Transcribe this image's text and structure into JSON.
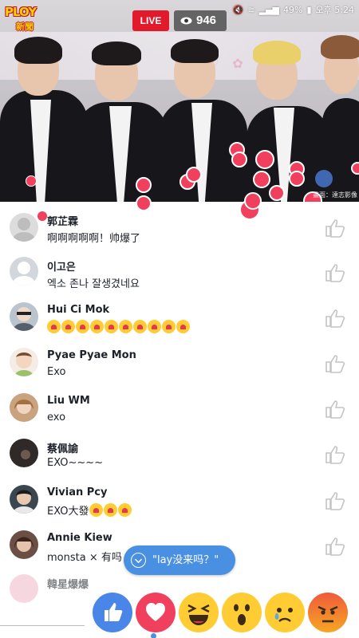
{
  "app": {
    "logo_top": "PLOY",
    "logo_bottom": "新聞"
  },
  "live": {
    "badge": "LIVE",
    "viewers": "946"
  },
  "status_bar": {
    "battery": "49%",
    "time": "오후 5:24"
  },
  "video": {
    "watermark": "畫面：達志影像",
    "backdrop_text": "♡ ✿"
  },
  "comments": [
    {
      "name": "郭芷霖",
      "text": "啊啊啊啊啊！帅爆了",
      "avatar": "#d8d8d8"
    },
    {
      "name": "이고은",
      "text": "엑소 존나 잘생겼네요",
      "avatar": "#cfd3d9"
    },
    {
      "name": "Hui Ci Mok",
      "text": "",
      "emoji_count": 10,
      "avatar": "#b7c2cc"
    },
    {
      "name": "Pyae Pyae Mon",
      "text": "Exo",
      "avatar": "#f2e0d3"
    },
    {
      "name": "Liu WM",
      "text": "exo",
      "avatar": "#caa27c"
    },
    {
      "name": "蔡佩諭",
      "text": "EXO~~~~",
      "avatar": "#3b3431"
    },
    {
      "name": "Vivian Pcy",
      "text": "EXO大發",
      "emoji_count": 3,
      "avatar": "#394650"
    },
    {
      "name": "Annie Kiew",
      "text": "monsta × 有吗",
      "avatar": "#6b4f45"
    },
    {
      "name": "韓星爆爆",
      "text": "",
      "avatar": "#f2b8c6"
    }
  ],
  "toast": {
    "text": "\"lay没来吗？\""
  },
  "reactions": [
    {
      "name": "like",
      "color": "#4a86e8"
    },
    {
      "name": "love",
      "color": "#f0405d"
    },
    {
      "name": "haha",
      "color": "#ffcc33"
    },
    {
      "name": "wow",
      "color": "#ffcc33"
    },
    {
      "name": "sad",
      "color": "#ffcc33"
    },
    {
      "name": "angry",
      "color": "#f05a3c"
    }
  ]
}
